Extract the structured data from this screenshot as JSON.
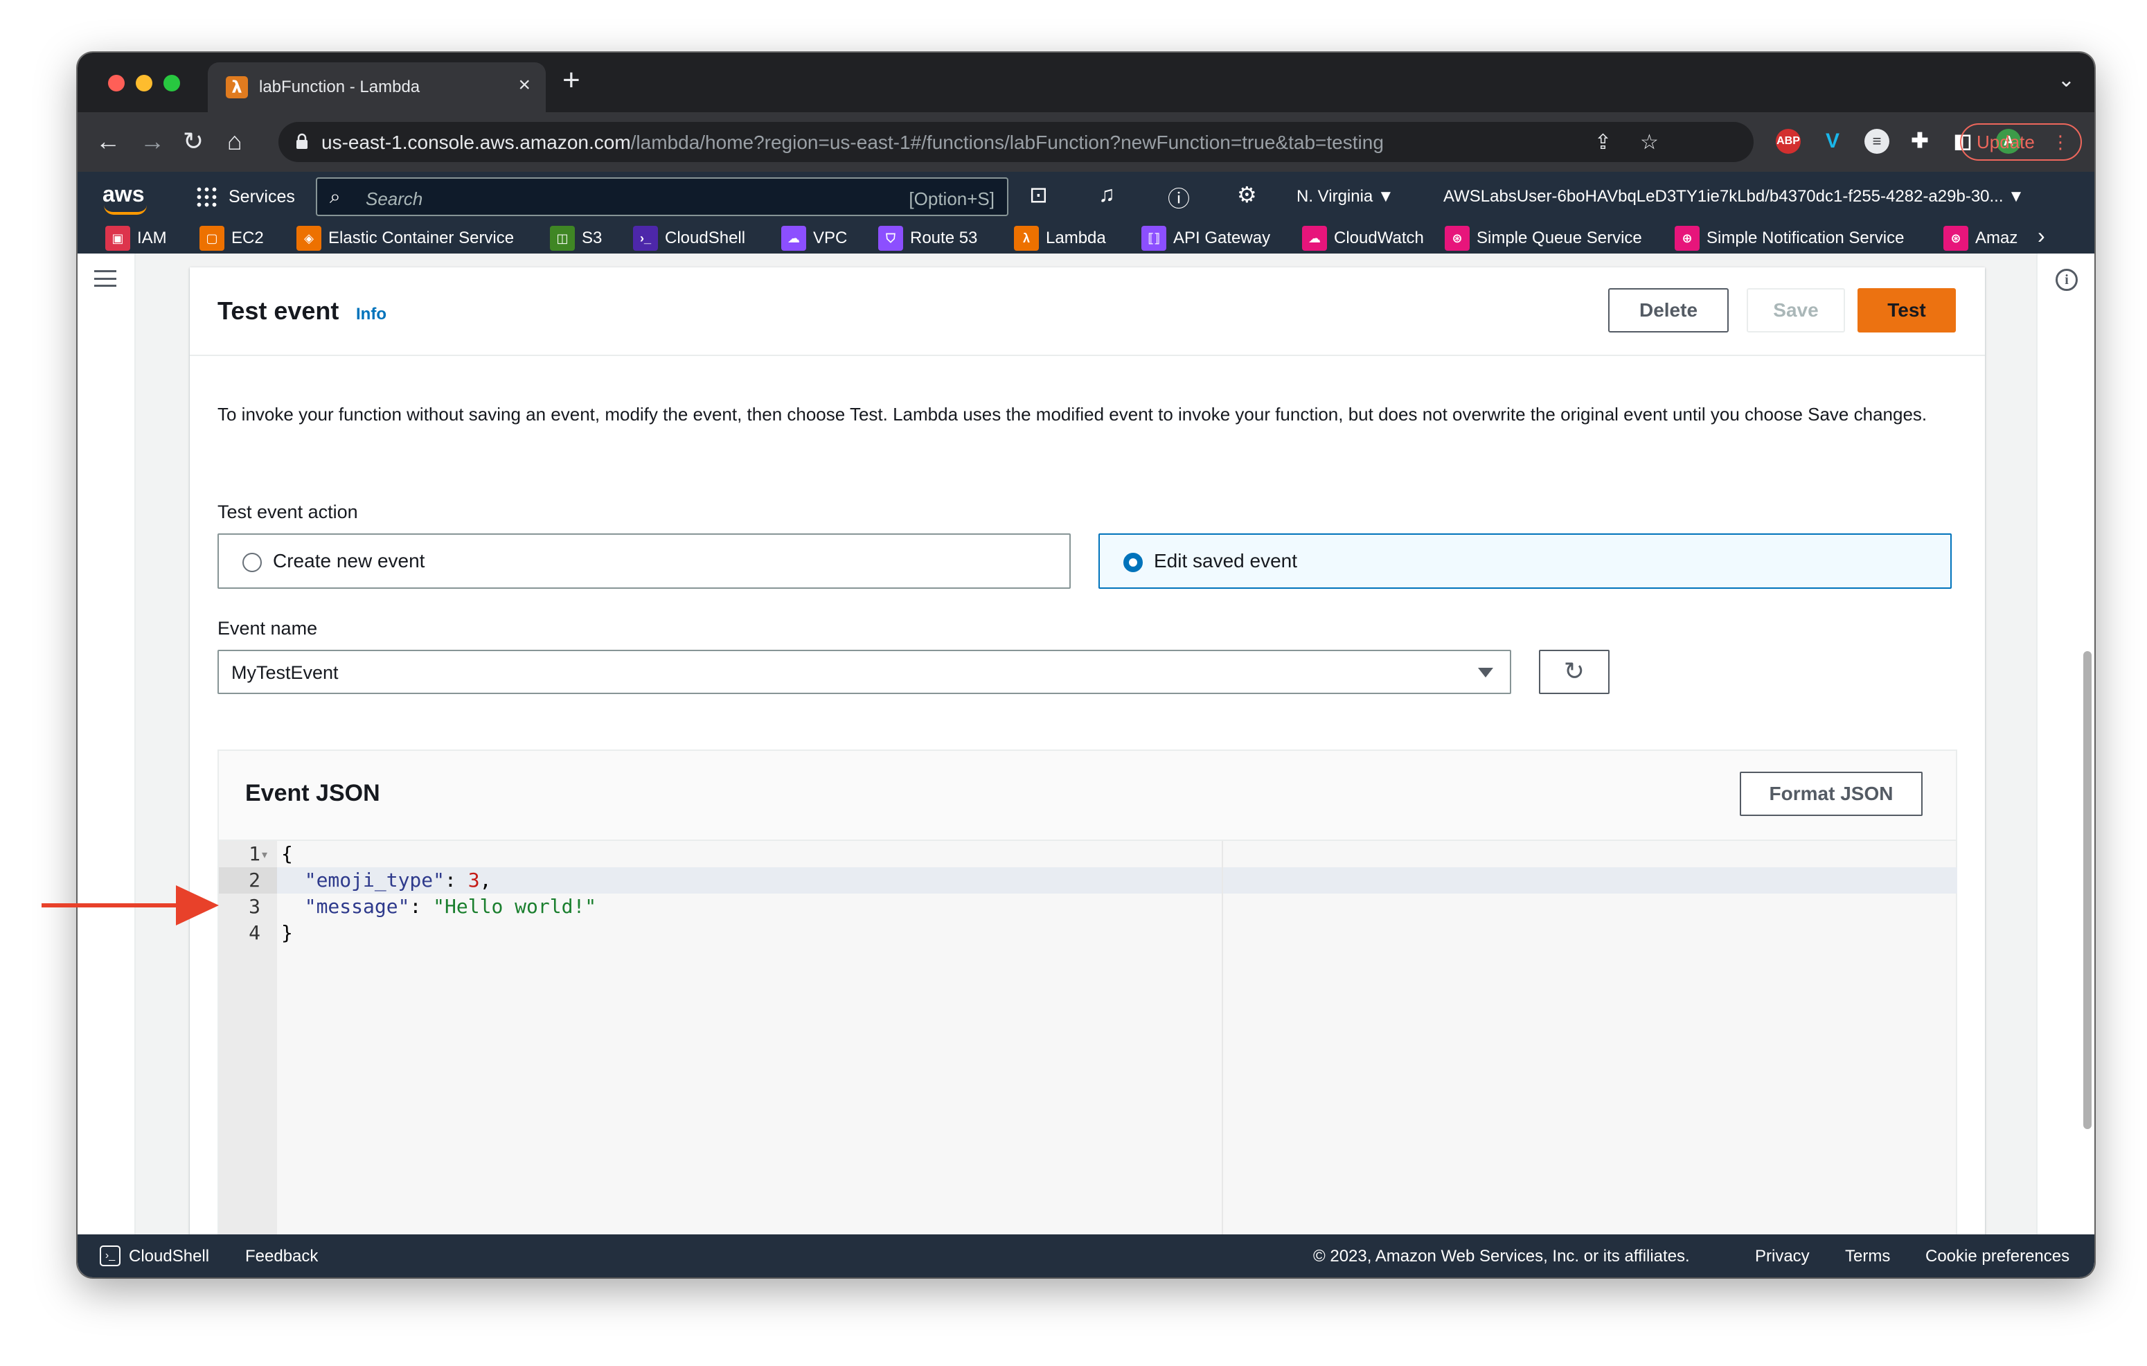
{
  "browser": {
    "tab_title": "labFunction - Lambda",
    "url_host": "us-east-1.console.aws.amazon.com",
    "url_path": "/lambda/home?region=us-east-1#/functions/labFunction?newFunction=true&tab=testing",
    "update_label": "Update",
    "profile_initial": "A",
    "abp_label": "ABP",
    "vimeo_label": "V"
  },
  "aws_header": {
    "logo": "aws",
    "services_label": "Services",
    "search_placeholder": "Search",
    "search_shortcut": "[Option+S]",
    "region": "N. Virginia ▼",
    "account": "AWSLabsUser-6boHAVbqLeD3TY1ie7kLbd/b4370dc1-f255-4282-a29b-30... ▼",
    "favorites": [
      {
        "label": "IAM",
        "color": "#dd344c"
      },
      {
        "label": "EC2",
        "color": "#ed7100"
      },
      {
        "label": "Elastic Container Service",
        "color": "#ed7100"
      },
      {
        "label": "S3",
        "color": "#3f8624"
      },
      {
        "label": "CloudShell",
        "color": "#4d27aa"
      },
      {
        "label": "VPC",
        "color": "#8c4fff"
      },
      {
        "label": "Route 53",
        "color": "#8c4fff"
      },
      {
        "label": "Lambda",
        "color": "#ed7100"
      },
      {
        "label": "API Gateway",
        "color": "#8c4fff"
      },
      {
        "label": "CloudWatch",
        "color": "#e7157b"
      },
      {
        "label": "Simple Queue Service",
        "color": "#e7157b"
      },
      {
        "label": "Simple Notification Service",
        "color": "#e7157b"
      },
      {
        "label": "Amaz",
        "color": "#e7157b"
      }
    ]
  },
  "test_event": {
    "title": "Test event",
    "info_label": "Info",
    "delete_label": "Delete",
    "save_label": "Save",
    "test_label": "Test",
    "description": "To invoke your function without saving an event, modify the event, then choose Test. Lambda uses the modified event to invoke your function, but does not overwrite the original event until you choose Save changes.",
    "action_label": "Test event action",
    "option_create": "Create new event",
    "option_edit": "Edit saved event",
    "selected_option": "Edit saved event",
    "event_name_label": "Event name",
    "event_name_value": "MyTestEvent"
  },
  "event_json": {
    "title": "Event JSON",
    "format_label": "Format JSON",
    "line_numbers": [
      "1",
      "2",
      "3",
      "4"
    ],
    "lines": {
      "l1": "{",
      "l2_key": "\"emoji_type\"",
      "l2_sep": ": ",
      "l2_val": "3",
      "l2_end": ",",
      "l3_key": "\"message\"",
      "l3_sep": ": ",
      "l3_val": "\"Hello world!\"",
      "l4": "}"
    }
  },
  "footer": {
    "cloudshell": "CloudShell",
    "feedback": "Feedback",
    "copyright": "© 2023, Amazon Web Services, Inc. or its affiliates.",
    "privacy": "Privacy",
    "terms": "Terms",
    "cookies": "Cookie preferences"
  },
  "colors": {
    "accent_orange": "#ec7211",
    "link_blue": "#0073bb",
    "aws_nav": "#232f3e",
    "annotation_red": "#e8412a"
  }
}
